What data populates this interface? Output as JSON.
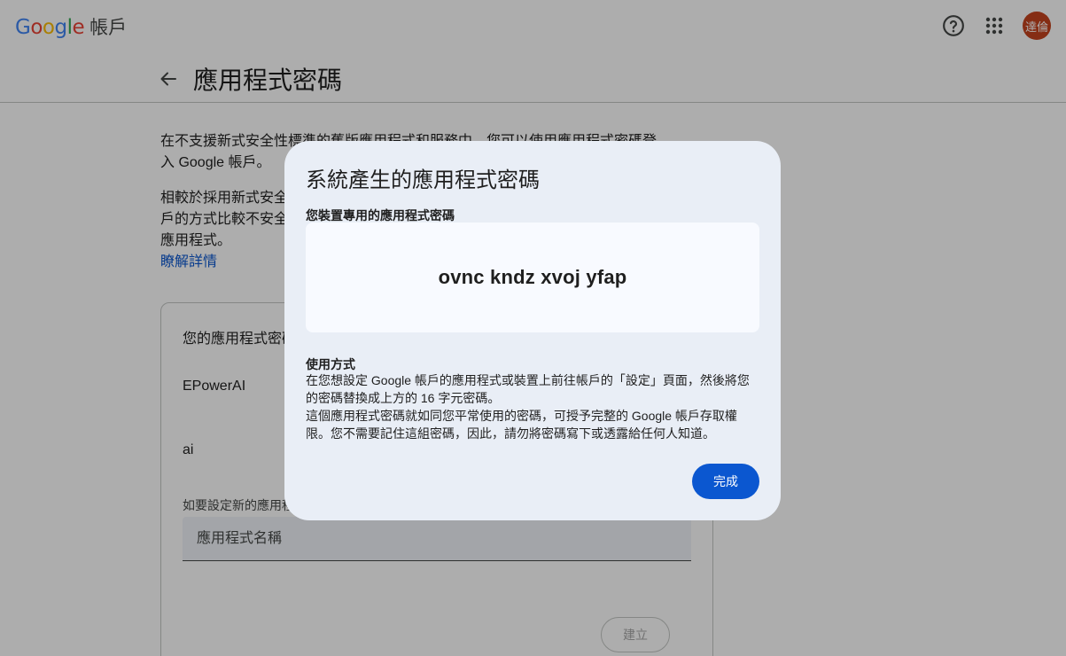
{
  "topbar": {
    "logo_letters": [
      {
        "ch": "G",
        "color": "#4285F4"
      },
      {
        "ch": "o",
        "color": "#EA4335"
      },
      {
        "ch": "o",
        "color": "#FBBC05"
      },
      {
        "ch": "g",
        "color": "#4285F4"
      },
      {
        "ch": "l",
        "color": "#34A853"
      },
      {
        "ch": "e",
        "color": "#EA4335"
      }
    ],
    "product": "帳戶",
    "help_icon": "help-circle-icon",
    "apps_icon": "apps-grid-icon",
    "avatar_text": "達倫",
    "avatar_color": "#c5431e"
  },
  "header": {
    "title": "應用程式密碼",
    "back_icon": "arrow-back-icon"
  },
  "content": {
    "para1": "在不支援新式安全性標準的舊版應用程式和服務中，您可以使用應用程式密碼登入 Google 帳戶。",
    "para2": "相較於採用新式安全性標準的最新版應用程式和服務，使用應用程式密碼登入帳戶的方式比較不安全。您必須在設定應用程式密碼前啟用兩步驟驗證，才能登入應用程式。",
    "learn_more": "瞭解詳情"
  },
  "card": {
    "title": "您的應用程式密碼",
    "passwords": [
      "EPowerAI",
      "ai"
    ],
    "new_label": "如要設定新的應用程式專用密碼，請在下方輸入密碼名稱…",
    "input_placeholder": "應用程式名稱",
    "create_label": "建立"
  },
  "dialog": {
    "title": "系統產生的應用程式密碼",
    "subtitle": "您裝置專用的應用程式密碼",
    "password": "ovnc kndz xvoj yfap",
    "usage_title": "使用方式",
    "usage_line1": "在您想設定 Google 帳戶的應用程式或裝置上前往帳戶的「設定」頁面，然後將您的密碼替換成上方的 16 字元密碼。",
    "usage_line2": "這個應用程式密碼就如同您平常使用的密碼，可授予完整的 Google 帳戶存取權限。您不需要記住這組密碼，因此，請勿將密碼寫下或透露給任何人知道。",
    "done_label": "完成",
    "accent": "#0b57d0"
  }
}
